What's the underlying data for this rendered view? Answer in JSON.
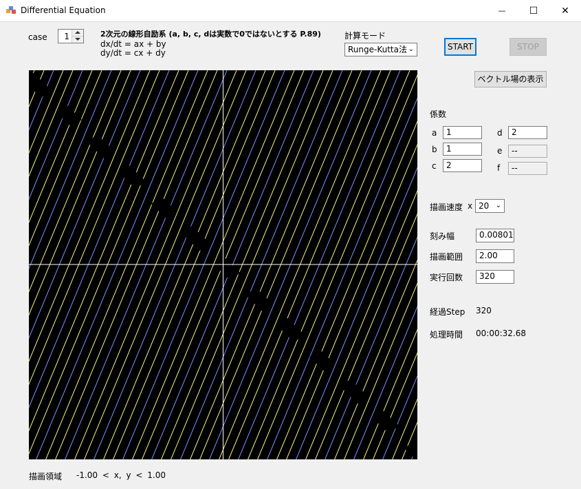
{
  "window": {
    "title": "Differential Equation",
    "minimize_glyph": "—",
    "maximize_glyph": "☐",
    "close_glyph": "✕"
  },
  "case": {
    "label": "case",
    "value": "1"
  },
  "equation": {
    "title": "2次元の線形自励系 (a, b, c, dは実数で0ではないとする P.89)",
    "line1": "dx/dt = ax + by",
    "line2": "dy/dt = cx + dy"
  },
  "mode": {
    "label": "計算モード",
    "selected": "Runge-Kutta法"
  },
  "buttons": {
    "start": "START",
    "stop": "STOP",
    "vector_field": "ベクトル場の表示"
  },
  "coefficients": {
    "label": "係数",
    "a": {
      "label": "a",
      "value": "1"
    },
    "b": {
      "label": "b",
      "value": "1"
    },
    "c": {
      "label": "c",
      "value": "2"
    },
    "d": {
      "label": "d",
      "value": "2"
    },
    "e": {
      "label": "e",
      "value": "--"
    },
    "f": {
      "label": "f",
      "value": "--"
    }
  },
  "speed": {
    "label": "描画速度",
    "prefix": "x",
    "selected": "20"
  },
  "step_width": {
    "label": "刻み幅",
    "value": "0.00801"
  },
  "draw_range": {
    "label": "描画範囲",
    "value": "2.00"
  },
  "iterations": {
    "label": "実行回数",
    "value": "320"
  },
  "elapsed_step": {
    "label": "経過Step",
    "value": "320"
  },
  "processing_time": {
    "label": "処理時間",
    "value": "00:00:32.68"
  },
  "region": {
    "label": "描画領域",
    "range": "-1.00 < x, y < 1.00"
  },
  "colors": {
    "yellow": "#f5f58a",
    "blue": "#7b93ff",
    "axis": "#ffffff",
    "background": "#000000"
  }
}
